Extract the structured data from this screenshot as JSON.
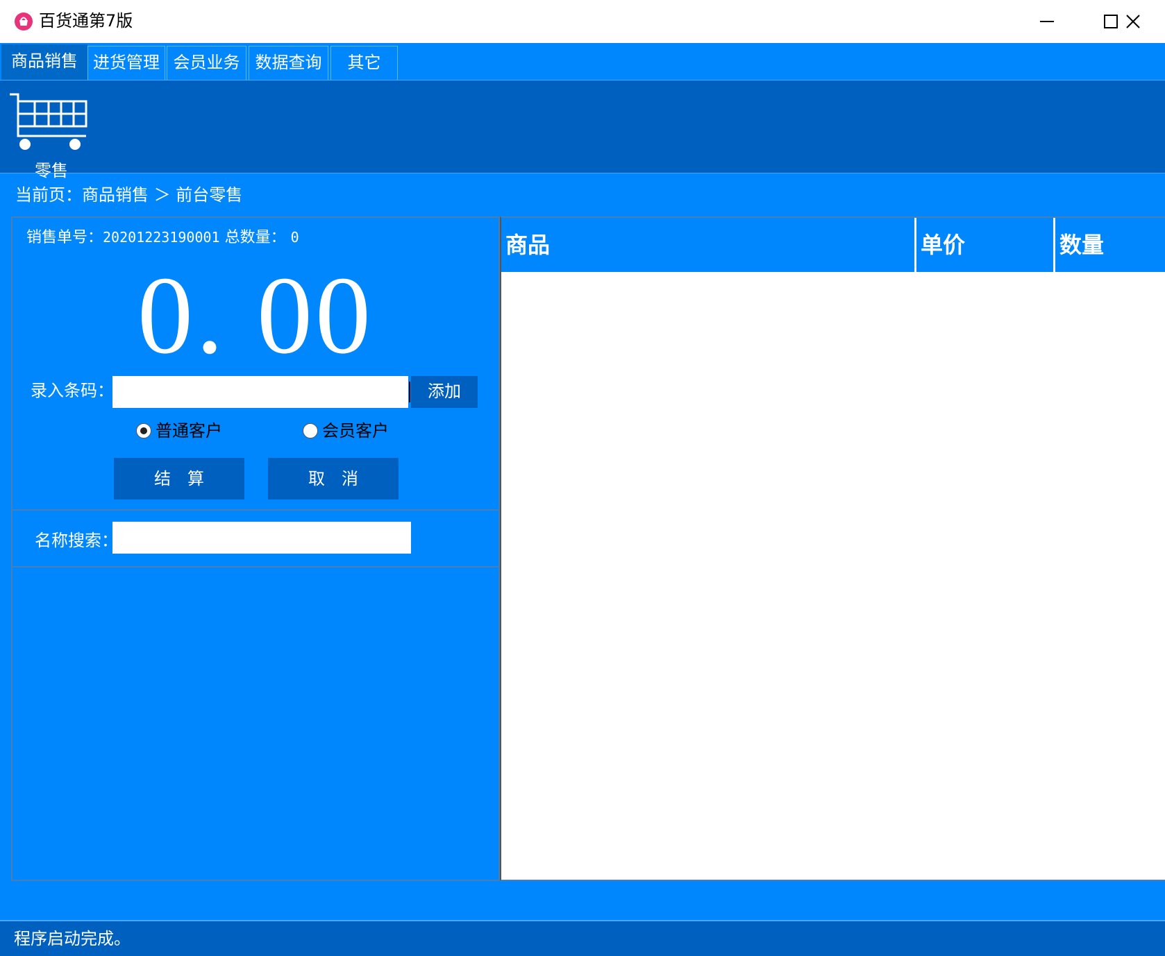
{
  "window": {
    "title": "百货通第7版",
    "icon": "shopping-basket-icon",
    "accent_color": "#0087fd",
    "dark_color": "#0060bf"
  },
  "tabs": [
    {
      "label": "商品销售",
      "active": true
    },
    {
      "label": "进货管理",
      "active": false
    },
    {
      "label": "会员业务",
      "active": false
    },
    {
      "label": "数据查询",
      "active": false
    },
    {
      "label": "其它",
      "active": false
    }
  ],
  "ribbon": {
    "retail": {
      "label": "零售",
      "icon": "shopping-cart-icon"
    }
  },
  "breadcrumb": "当前页：商品销售 ＞ 前台零售",
  "sale": {
    "order_label": "销售单号：",
    "order_number": "20201223190001",
    "total_qty_label": "总数量：",
    "total_qty": "0",
    "amount": "0. 00",
    "barcode_label": "录入条码：",
    "barcode_value": "",
    "add_button": "添加",
    "customer_types": [
      {
        "label": "普通客户",
        "checked": true
      },
      {
        "label": "会员客户",
        "checked": false
      }
    ],
    "checkout_button": "结　算",
    "cancel_button": "取　消",
    "name_search_label": "名称搜索：",
    "name_search_value": ""
  },
  "grid": {
    "columns": [
      "商品",
      "单价",
      "数量"
    ],
    "rows": []
  },
  "status": "程序启动完成。"
}
